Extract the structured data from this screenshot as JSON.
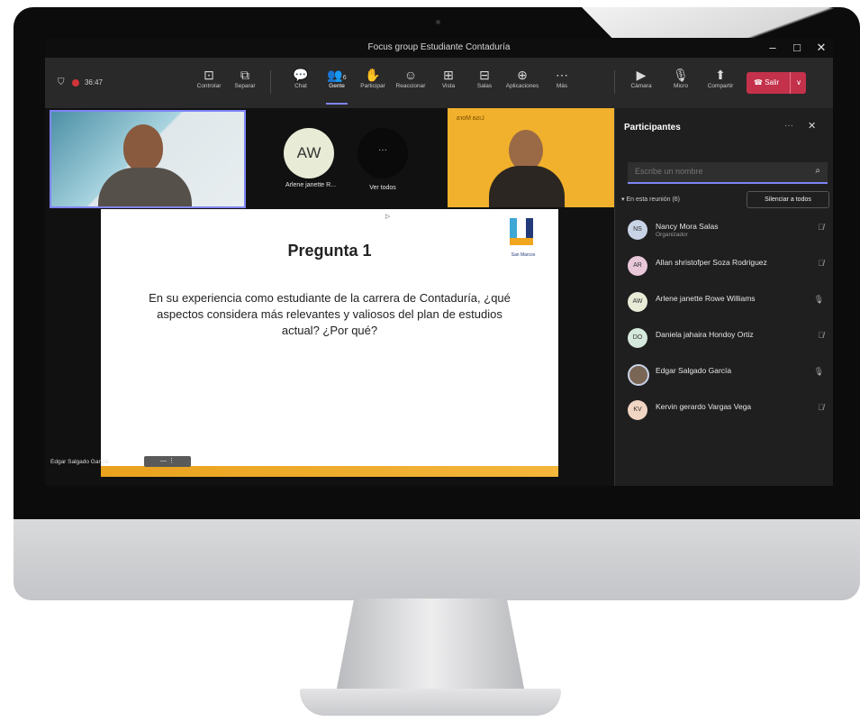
{
  "window": {
    "title": "Focus group Estudiante Contaduría",
    "minimize": "–",
    "maximize": "□",
    "close": "✕"
  },
  "toolbar": {
    "timer": "36:47",
    "items": [
      {
        "label": "Controlar",
        "icon": "⊡"
      },
      {
        "label": "Separar",
        "icon": "⧉"
      },
      {
        "label": "Chat",
        "icon": "💬"
      },
      {
        "label": "Gente",
        "icon": "👥",
        "badge": "6"
      },
      {
        "label": "Participar",
        "icon": "✋"
      },
      {
        "label": "Reaccionar",
        "icon": "☺"
      },
      {
        "label": "Vista",
        "icon": "⊞"
      },
      {
        "label": "Salas",
        "icon": "⊟"
      },
      {
        "label": "Aplicaciones",
        "icon": "⊕"
      },
      {
        "label": "Más",
        "icon": "⋯"
      },
      {
        "label": "Cámara",
        "icon": "▶"
      },
      {
        "label": "Micro",
        "icon": "🎙"
      },
      {
        "label": "Compartir",
        "icon": "⬆"
      }
    ],
    "leave_label": "Salir",
    "leave_dropdown": "∨"
  },
  "stage": {
    "tile_avatar_initials": "AW",
    "tile_avatar_name": "Arlene janette R...",
    "more_tile_icon": "···",
    "more_tile_label": "Ver todos",
    "mirrored_name": "Lisa Mora",
    "presenter_name": "Edgar Salgado García",
    "presenter_controls": "—  ⋮"
  },
  "slide": {
    "title": "Pregunta 1",
    "text": "En su experiencia como estudiante de la carrera de Contaduría, ¿qué aspectos considera más relevantes y valiosos del plan de estudios actual? ¿Por qué?",
    "logo_text": "San Marcos"
  },
  "participants": {
    "header": "Participantes",
    "more": "···",
    "close": "✕",
    "search_placeholder": "Escribe un nombre",
    "section": "▾ En esta reunión (6)",
    "mute_all": "Silenciar a todos",
    "list": [
      {
        "initials": "NS",
        "name": "Nancy Mora Salas",
        "role": "Organizador",
        "color": "#c8d3e6"
      },
      {
        "initials": "AR",
        "name": "Allan shristofper Soza Rodriguez",
        "role": "",
        "color": "#e8c7d9"
      },
      {
        "initials": "AW",
        "name": "Arlene janette Rowe Williams",
        "role": "",
        "color": "#e8ecd7"
      },
      {
        "initials": "DO",
        "name": "Daniela jahaira Hondoy Ortiz",
        "role": "",
        "color": "#d5e8dc"
      },
      {
        "initials": "",
        "name": "Edgar Salgado García",
        "role": "",
        "color": "#7a6655"
      },
      {
        "initials": "KV",
        "name": "Kervin gerardo Vargas Vega",
        "role": "",
        "color": "#f1d5c3"
      }
    ]
  }
}
